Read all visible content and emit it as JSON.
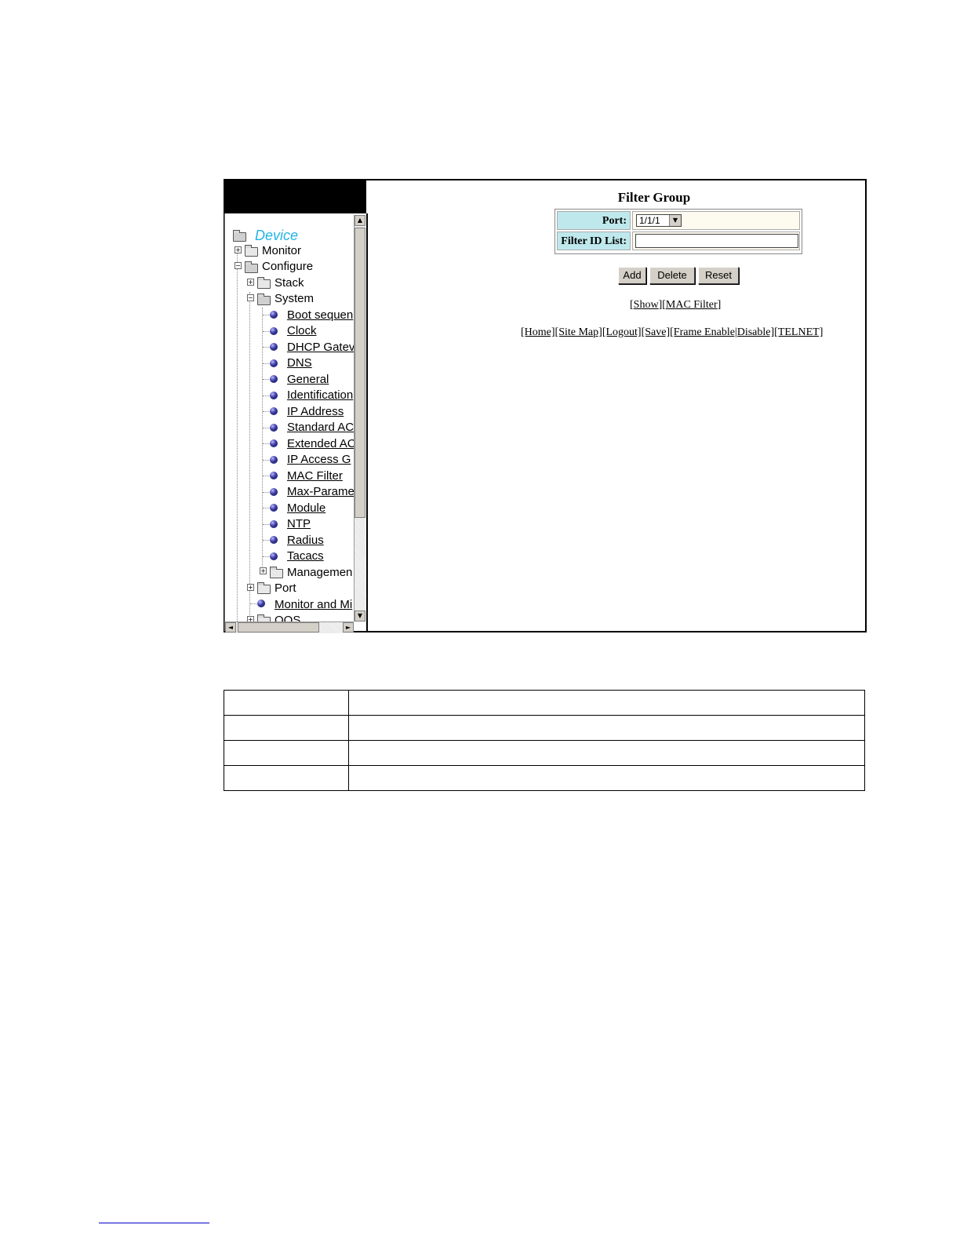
{
  "nav": {
    "root": "Device",
    "items": [
      {
        "label": "Monitor",
        "link": false
      },
      {
        "label": "Configure",
        "link": false
      },
      {
        "label": "Stack",
        "link": false
      },
      {
        "label": "System",
        "link": false
      },
      {
        "label": "Boot sequen",
        "link": true
      },
      {
        "label": "Clock",
        "link": true
      },
      {
        "label": "DHCP Gatev",
        "link": true
      },
      {
        "label": "DNS",
        "link": true
      },
      {
        "label": "General",
        "link": true
      },
      {
        "label": "Identification",
        "link": true
      },
      {
        "label": "IP Address",
        "link": true
      },
      {
        "label": "Standard AC",
        "link": true
      },
      {
        "label": "Extended AC",
        "link": true
      },
      {
        "label": "IP Access G",
        "link": true
      },
      {
        "label": "MAC Filter",
        "link": true
      },
      {
        "label": "Max-Parame",
        "link": true
      },
      {
        "label": "Module",
        "link": true
      },
      {
        "label": "NTP",
        "link": true
      },
      {
        "label": "Radius",
        "link": true
      },
      {
        "label": "Tacacs",
        "link": true
      },
      {
        "label": "Managemen",
        "link": false
      },
      {
        "label": "Port",
        "link": false
      },
      {
        "label": "Monitor and Mi",
        "link": true
      },
      {
        "label": "QOS",
        "link": false
      }
    ]
  },
  "scroll": {
    "up": "▲",
    "down": "▼",
    "left": "◄",
    "right": "►"
  },
  "form": {
    "title": "Filter Group",
    "port_label": "Port:",
    "port_value": "1/1/1",
    "port_arrow": "▼",
    "filter_label": "Filter ID List:",
    "filter_value": ""
  },
  "buttons": {
    "add": "Add",
    "delete": "Delete",
    "reset": "Reset"
  },
  "links_row1": {
    "open": "[",
    "show": "Show",
    "mid": "][",
    "mac_filter": "MAC Filter",
    "close": "]"
  },
  "links_row2": {
    "home": "[Home]",
    "site_map": "[Site Map]",
    "logout": "[Logout]",
    "save": "[Save]",
    "frame": "[Frame Enable|Disable]",
    "telnet": "[TELNET]"
  }
}
